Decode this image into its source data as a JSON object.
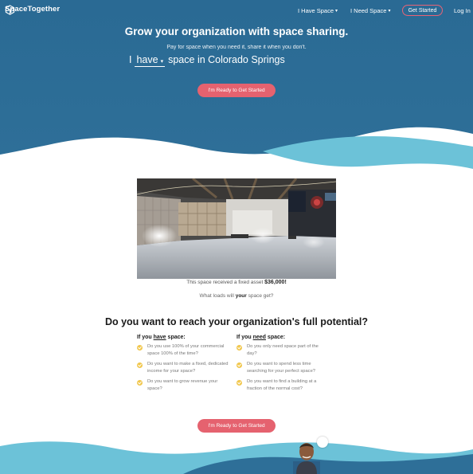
{
  "brand": {
    "name": "SpaceTogether",
    "logo_icon": "cube-logo-icon"
  },
  "nav": {
    "have_space": "I Have Space",
    "need_space": "I Need Space",
    "cta": "Get Started",
    "login": "Log In"
  },
  "hero": {
    "title": "Grow your organization with space sharing.",
    "subtitle": "Pay for space when you need it, share it when you don't.",
    "prefix": "I",
    "mode_value": "have",
    "suffix": "space in Colorado Springs",
    "cta": "I'm Ready to Get Started"
  },
  "showcase": {
    "caption_prefix": "This space received a fixed asset",
    "caption_amount": "$36,000!",
    "question_prefix": "What loads will",
    "question_emphasis": "your",
    "question_suffix": "space get?"
  },
  "potential": {
    "title": "Do you want to reach your organization's full potential?",
    "have_col": {
      "head_prefix": "If you",
      "head_emphasis": "have",
      "head_suffix": "space:",
      "items": [
        "Do you use 100% of your commercial space 100% of the time?",
        "Do you want to make a fixed, dedicated income for your space?",
        "Do you want to grow revenue your space?"
      ]
    },
    "need_col": {
      "head_prefix": "If you",
      "head_emphasis": "need",
      "head_suffix": "space:",
      "items": [
        "Do you only need space part of the day?",
        "Do you want to spend less time searching for your perfect space?",
        "Do you want to find a building at a fraction of the normal cost?"
      ]
    },
    "cta": "I'm Ready to Get Started"
  },
  "colors": {
    "hero_dark": "#2e6d96",
    "hero_light": "#6fc3d9",
    "accent": "#e5626f",
    "check": "#f1c74d"
  }
}
